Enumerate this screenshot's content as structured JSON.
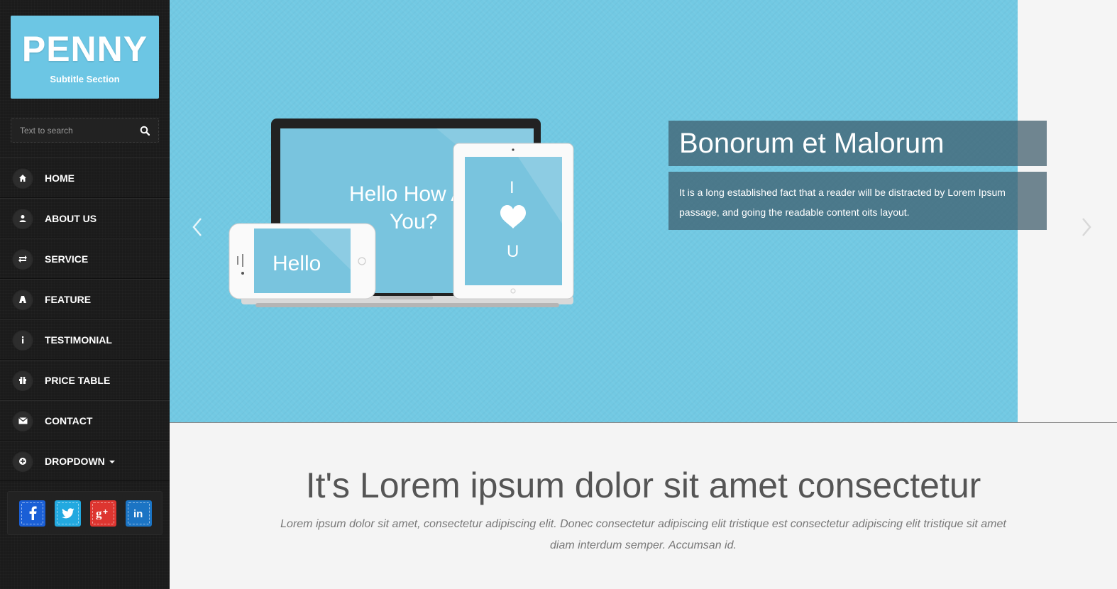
{
  "brand": {
    "title": "PENNY",
    "subtitle": "Subtitle Section"
  },
  "search": {
    "placeholder": "Text to search"
  },
  "nav": [
    {
      "label": "HOME",
      "icon": "home-icon"
    },
    {
      "label": "ABOUT US",
      "icon": "user-icon"
    },
    {
      "label": "SERVICE",
      "icon": "retweet-icon"
    },
    {
      "label": "FEATURE",
      "icon": "road-icon"
    },
    {
      "label": "TESTIMONIAL",
      "icon": "info-icon"
    },
    {
      "label": "PRICE TABLE",
      "icon": "gift-icon"
    },
    {
      "label": "CONTACT",
      "icon": "envelope-icon"
    },
    {
      "label": "DROPDOWN",
      "icon": "plus-circle-icon"
    }
  ],
  "social": [
    {
      "name": "facebook",
      "glyph": "f",
      "color": "#1a5fd6"
    },
    {
      "name": "twitter",
      "glyph": "t",
      "color": "#22a9e0"
    },
    {
      "name": "google-plus",
      "glyph": "g+",
      "color": "#dd3530"
    },
    {
      "name": "linkedin",
      "glyph": "in",
      "color": "#1b74c4"
    }
  ],
  "slider": {
    "caption_title": "Bonorum et Malorum",
    "caption_text": "It is a long established fact that a reader will be distracted by Lorem Ipsum passage, and going the readable content oits layout.",
    "laptop_text_1": "Hello How A",
    "laptop_text_2": "You?",
    "phone_text": "Hello",
    "tablet_line_1": "I",
    "tablet_line_3": "U",
    "background_color": "#72c9e3"
  },
  "intro": {
    "heading": "It's Lorem ipsum dolor sit amet consectetur",
    "text": "Lorem ipsum dolor sit amet, consectetur adipiscing elit. Donec consectetur adipiscing elit tristique est consectetur adipiscing elit tristique sit amet diam interdum semper. Accumsan id."
  }
}
